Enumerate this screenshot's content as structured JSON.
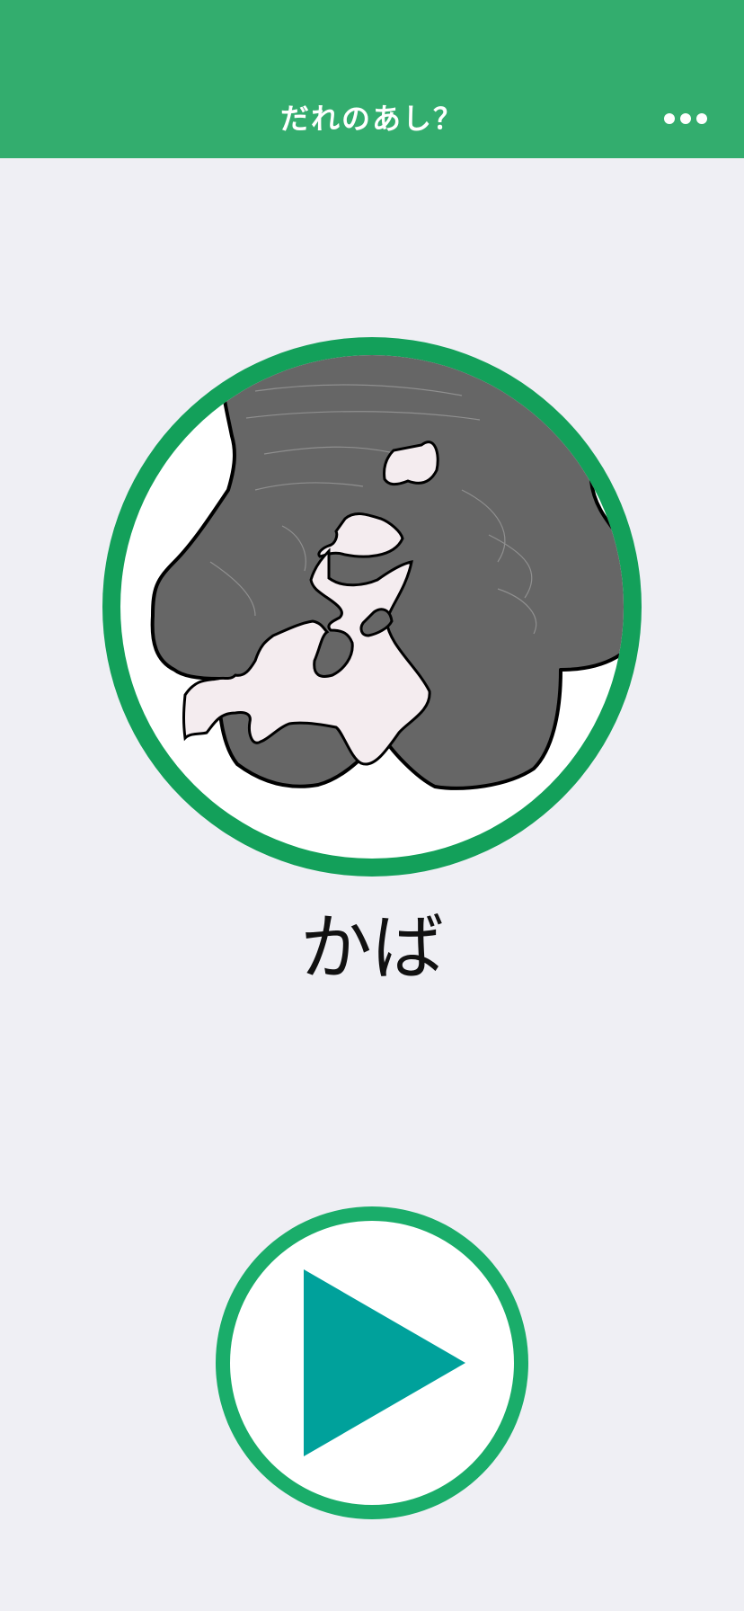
{
  "header": {
    "title": "だれのあし？",
    "more_icon": "more-dots-icon",
    "background_color": "#33ad6e"
  },
  "quiz": {
    "image_icon": "hippo-foot-illustration",
    "answer": "かば",
    "frame_color": "#13a05a"
  },
  "play": {
    "icon": "play-icon",
    "ring_color": "#1aad6a",
    "triangle_color": "#00a19b"
  }
}
